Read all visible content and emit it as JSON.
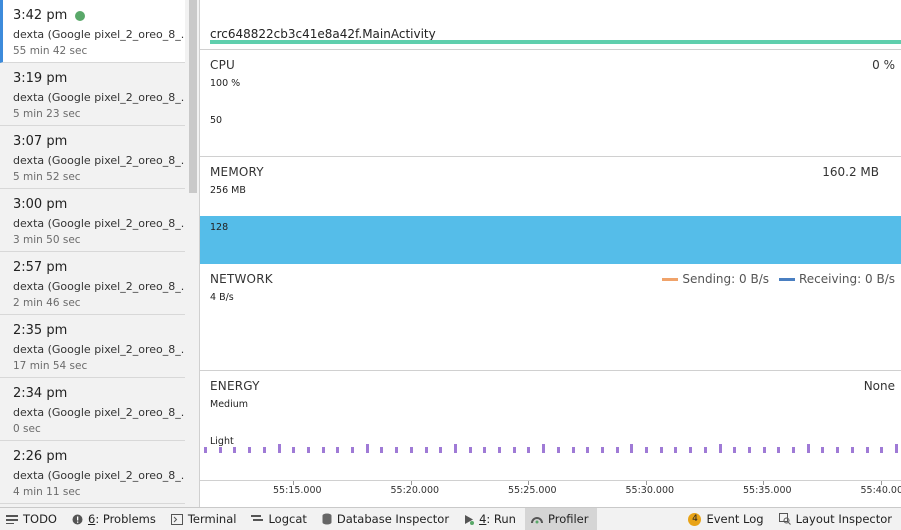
{
  "sessions": [
    {
      "time": "3:42 pm",
      "device": "dexta (Google pixel_2_oreo_8_...",
      "duration": "55 min 42 sec",
      "active": true
    },
    {
      "time": "3:19 pm",
      "device": "dexta (Google pixel_2_oreo_8_...",
      "duration": "5 min 23 sec"
    },
    {
      "time": "3:07 pm",
      "device": "dexta (Google pixel_2_oreo_8_...",
      "duration": "5 min 52 sec"
    },
    {
      "time": "3:00 pm",
      "device": "dexta (Google pixel_2_oreo_8_...",
      "duration": "3 min 50 sec"
    },
    {
      "time": "2:57 pm",
      "device": "dexta (Google pixel_2_oreo_8_...",
      "duration": "2 min 46 sec"
    },
    {
      "time": "2:35 pm",
      "device": "dexta (Google pixel_2_oreo_8_...",
      "duration": "17 min 54 sec"
    },
    {
      "time": "2:34 pm",
      "device": "dexta (Google pixel_2_oreo_8_...",
      "duration": "0 sec"
    },
    {
      "time": "2:26 pm",
      "device": "dexta (Google pixel_2_oreo_8_...",
      "duration": "4 min 11 sec"
    }
  ],
  "activity": {
    "label": "crc648822cb3c41e8a42f.MainActivity",
    "color": "#5fcfad"
  },
  "cpu": {
    "title": "CPU",
    "value": "0 %",
    "ticks": [
      "100 %",
      "50"
    ]
  },
  "memory": {
    "title": "MEMORY",
    "value": "160.2 MB",
    "ticks": [
      "256 MB",
      "128"
    ],
    "fill_color": "#55bde9"
  },
  "network": {
    "title": "NETWORK",
    "tick": "4 B/s",
    "sending": {
      "label": "Sending: 0 B/s",
      "color": "#f0a36a"
    },
    "receiving": {
      "label": "Receiving: 0 B/s",
      "color": "#4a7fc1"
    }
  },
  "energy": {
    "title": "ENERGY",
    "value": "None",
    "ticks": [
      "Medium",
      "Light"
    ],
    "bar_color": "#9f7ad6"
  },
  "time_axis": [
    "55:15.000",
    "55:20.000",
    "55:25.000",
    "55:30.000",
    "55:35.000",
    "55:40.000"
  ],
  "toolbar": {
    "todo": "TODO",
    "problems_num": "6",
    "problems": ": Problems",
    "terminal": "Terminal",
    "logcat": "Logcat",
    "database": "Database Inspector",
    "run_num": "4",
    "run": ": Run",
    "profiler": "Profiler",
    "event_log_count": "4",
    "event_log": "Event Log",
    "layout_inspector": "Layout Inspector"
  },
  "icons": {
    "todo": "list-icon",
    "problems": "warning-circle-icon",
    "terminal": "terminal-icon",
    "logcat": "logcat-icon",
    "database": "database-icon",
    "run": "play-icon",
    "profiler": "gauge-icon",
    "layout_inspector": "inspect-icon"
  }
}
